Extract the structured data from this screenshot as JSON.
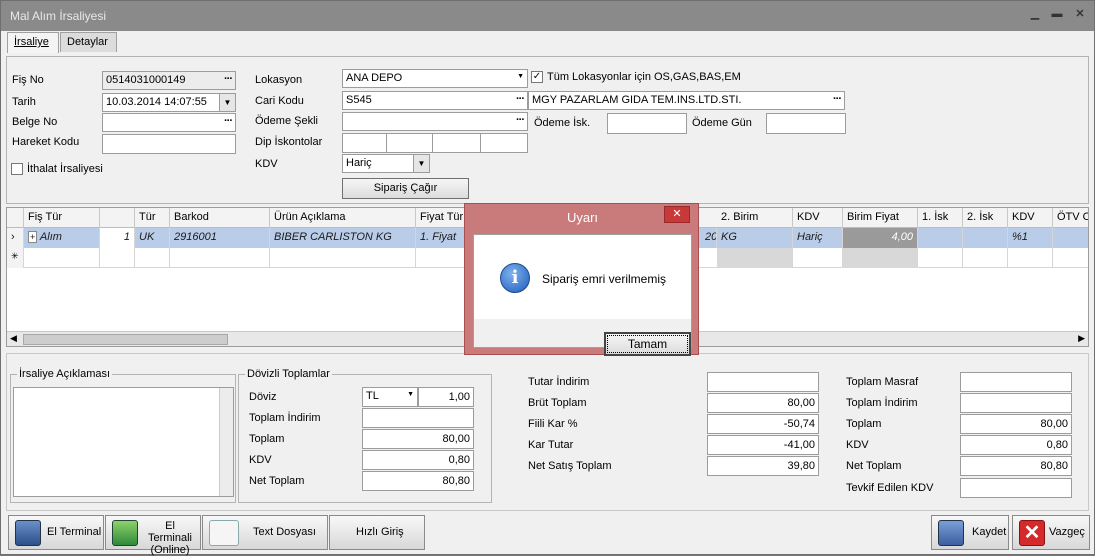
{
  "window": {
    "title": "Mal Alım İrsaliyesi"
  },
  "tabs": [
    {
      "label": "İrsaliye"
    },
    {
      "label": "Detaylar"
    }
  ],
  "header": {
    "fis_no_label": "Fiş No",
    "fis_no": "0514031000149",
    "tarih_label": "Tarih",
    "tarih": "10.03.2014 14:07:55",
    "belge_no_label": "Belge No",
    "belge_no": "",
    "hareket_kodu_label": "Hareket Kodu",
    "hareket_kodu": "",
    "ithalat_label": "İthalat İrsaliyesi",
    "lokasyon_label": "Lokasyon",
    "lokasyon": "ANA DEPO",
    "tum_lokasyon_label": "Tüm Lokasyonlar için OS,GAS,BAS,EM",
    "cari_kodu_label": "Cari Kodu",
    "cari_kodu": "S545",
    "cari_adi": "MGY PAZARLAM GIDA TEM.INS.LTD.STI.",
    "odeme_sekli_label": "Ödeme Şekli",
    "odeme_sekli": "",
    "odeme_isk_label": "Ödeme İsk.",
    "odeme_gun_label": "Ödeme Gün",
    "dip_iskontolar_label": "Dip İskontolar",
    "kdv_label": "KDV",
    "kdv": "Hariç",
    "siparis_button": "Sipariş Çağır"
  },
  "grid": {
    "columns": [
      "Fiş Tür",
      "",
      "Tür",
      "Barkod",
      "Ürün Açıklama",
      "Fiyat Tür",
      "2. Birim",
      "KDV",
      "Birim Fiyat",
      "1. İsk",
      "2. İsk",
      "KDV",
      "ÖTV O"
    ],
    "row": {
      "fis_tur": "Alım",
      "qty": "1",
      "tur": "UK",
      "barkod": "2916001",
      "urun": "BIBER CARLISTON KG",
      "fiyat_tur": "1. Fiyat",
      "hidden_tail": "20",
      "birim2": "KG",
      "kdv": "Hariç",
      "birim_fiyat": "4,00",
      "isk1": "",
      "isk2": "",
      "kdv_rate": "%1"
    }
  },
  "irsaliye_aciklamasi": {
    "title": "İrsaliye Açıklaması"
  },
  "dovizli": {
    "title": "Dövizli Toplamlar",
    "doviz_label": "Döviz",
    "doviz": "TL",
    "kur": "1,00",
    "toplam_indirim_label": "Toplam İndirim",
    "toplam_indirim": "",
    "toplam_label": "Toplam",
    "toplam": "80,00",
    "kdv_label": "KDV",
    "kdv": "0,80",
    "net_toplam_label": "Net Toplam",
    "net_toplam": "80,80"
  },
  "mid_totals": {
    "tutar_indirim_label": "Tutar İndirim",
    "tutar_indirim": "",
    "brut_toplam_label": "Brüt Toplam",
    "brut_toplam": "80,00",
    "fiili_kar_label": "Fiili Kar %",
    "fiili_kar": "-50,74",
    "kar_tutar_label": "Kar Tutar",
    "kar_tutar": "-41,00",
    "net_satis_label": "Net Satış Toplam",
    "net_satis": "39,80"
  },
  "right_totals": {
    "toplam_masraf_label": "Toplam Masraf",
    "toplam_masraf": "",
    "toplam_indirim_label": "Toplam İndirim",
    "toplam_indirim": "",
    "toplam_label": "Toplam",
    "toplam": "80,00",
    "kdv_label": "KDV",
    "kdv": "0,80",
    "net_toplam_label": "Net Toplam",
    "net_toplam": "80,80",
    "tevkif_label": "Tevkif Edilen KDV",
    "tevkif": ""
  },
  "footer": {
    "el_terminal": "El Terminal",
    "el_terminal_online_1": "El Terminali",
    "el_terminal_online_2": "(Online)",
    "text_dosyasi": "Text Dosyası",
    "hizli_giris": "Hızlı Giriş",
    "kaydet": "Kaydet",
    "vazgec": "Vazgeç"
  },
  "dialog": {
    "title": "Uyarı",
    "message": "Sipariş emri verilmemiş",
    "ok": "Tamam",
    "close": "✕"
  }
}
